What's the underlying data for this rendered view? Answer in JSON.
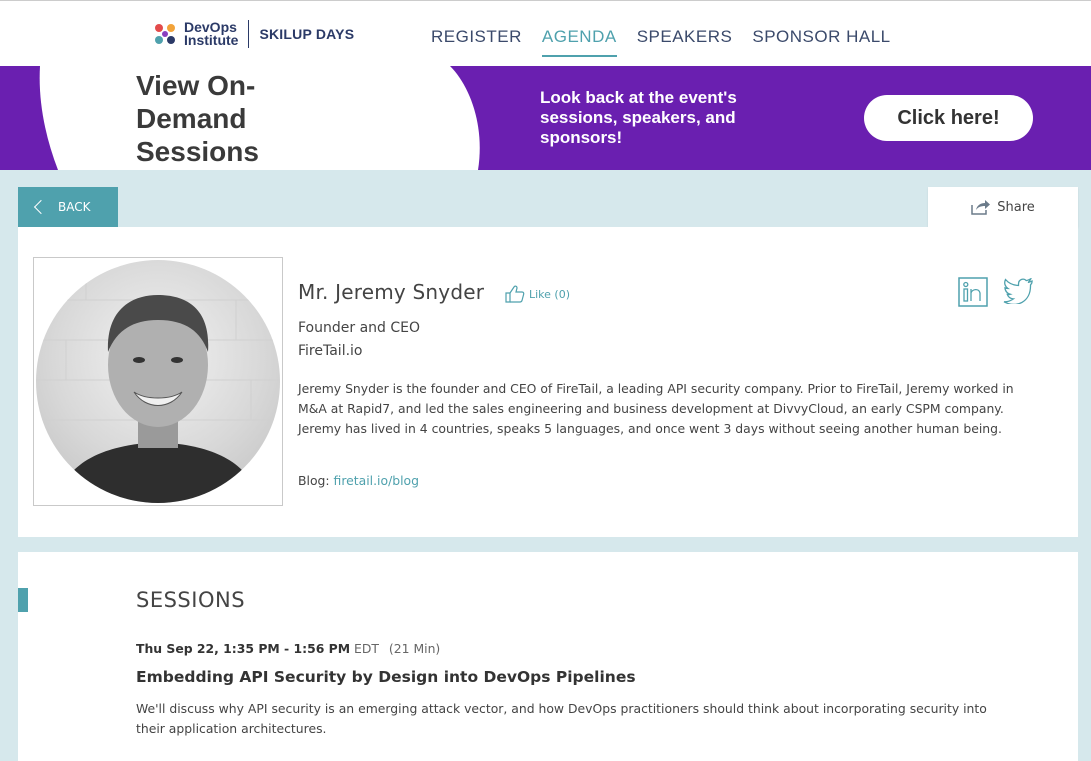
{
  "header": {
    "logo_line1": "DevOps",
    "logo_line2": "Institute",
    "logo_skill": "SKILUP DAYS",
    "nav": [
      {
        "label": "REGISTER",
        "active": false
      },
      {
        "label": "AGENDA",
        "active": true
      },
      {
        "label": "SPEAKERS",
        "active": false
      },
      {
        "label": "SPONSOR HALL",
        "active": false
      }
    ]
  },
  "banner": {
    "title": "View On-Demand Sessions",
    "text": "Look back at the event's sessions, speakers, and sponsors!",
    "button": "Click here!",
    "bg_color": "#6a1fb0"
  },
  "actions": {
    "back": "BACK",
    "share": "Share"
  },
  "speaker": {
    "name": "Mr. Jeremy Snyder",
    "like": "Like (0)",
    "role": "Founder and CEO",
    "company": "FireTail.io",
    "bio": "Jeremy Snyder is the founder and CEO of FireTail, a leading API security company. Prior to FireTail, Jeremy worked in M&A at Rapid7, and led the sales engineering and business development at DivvyCloud, an early CSPM company. Jeremy has lived in 4 countries, speaks 5 languages, and once went 3 days without seeing another human being.",
    "blog_label": "Blog:",
    "blog_link": "firetail.io/blog",
    "social": [
      "linkedin-icon",
      "twitter-icon"
    ]
  },
  "sessions": {
    "heading": "SESSIONS",
    "items": [
      {
        "date_time": "Thu Sep 22, 1:35 PM - 1:56 PM",
        "timezone": "EDT",
        "duration": "(21 Min)",
        "title": "Embedding API Security by Design into DevOps Pipelines",
        "description": "We'll discuss why API security is an emerging attack vector, and how DevOps practitioners should think about incorporating security into their application architectures."
      }
    ]
  },
  "colors": {
    "accent": "#4fa1ad",
    "nav_text": "#3b4a6b",
    "page_bg": "#d6e8ec"
  }
}
